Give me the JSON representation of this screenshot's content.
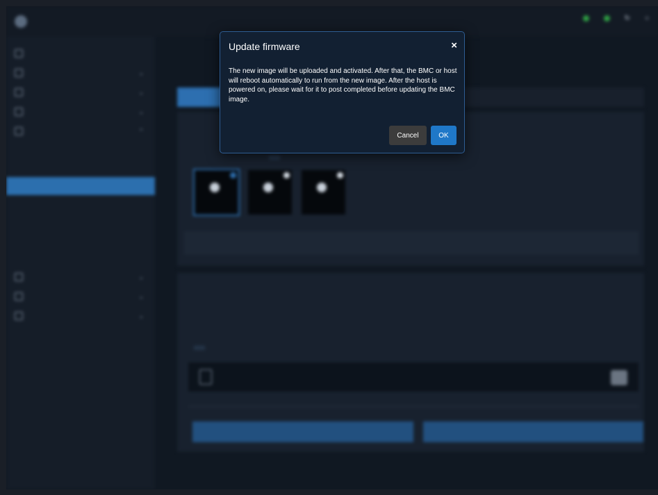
{
  "colors": {
    "accent": "#1f78c8",
    "background": "#101822",
    "modal_bg": "#122032",
    "status_ok": "#2ea043"
  },
  "header": {
    "breadcrumb": "",
    "items": [
      {
        "icon": "status-dot-icon",
        "label": ""
      },
      {
        "icon": "status-dot-icon",
        "label": ""
      },
      {
        "icon": "refresh-icon",
        "label": ""
      },
      {
        "icon": "user-icon",
        "label": ""
      }
    ]
  },
  "sidebar": {
    "items": [
      {
        "label": "",
        "icon": "dashboard-icon"
      },
      {
        "label": "",
        "icon": "system-icon"
      },
      {
        "label": "",
        "icon": "logs-icon"
      },
      {
        "label": "",
        "icon": "configuration-icon"
      },
      {
        "label": "",
        "icon": "operations-icon"
      }
    ],
    "sub_items": [
      "",
      "",
      "",
      "",
      "",
      "",
      ""
    ],
    "active_sub_index": 2,
    "items_after": [
      {
        "label": "",
        "icon": "security-icon"
      },
      {
        "label": "",
        "icon": "resource-icon"
      },
      {
        "label": "",
        "icon": "maintenance-icon"
      }
    ]
  },
  "main": {
    "page_title": "",
    "tabs": [
      {
        "label": ""
      },
      {
        "label": ""
      }
    ],
    "step1": {
      "title": "",
      "option_label": "",
      "option_btn": "",
      "cards": [
        {
          "label": "",
          "selected": true
        },
        {
          "label": "",
          "selected": false
        },
        {
          "label": "",
          "selected": false
        }
      ],
      "wide_button": ""
    },
    "step2": {
      "title": "",
      "file_label": "",
      "add_btn": "",
      "file_name": "",
      "file_subtitle": "",
      "size": "",
      "cancel_btn": "",
      "start_btn": ""
    }
  },
  "modal": {
    "title": "Update firmware",
    "close_glyph": "×",
    "body": "The new image will be uploaded and activated. After that, the BMC or host will reboot automatically to run from the new image. After the host is powered on, please wait for it to post completed before updating the BMC image.",
    "cancel_label": "Cancel",
    "ok_label": "OK"
  }
}
